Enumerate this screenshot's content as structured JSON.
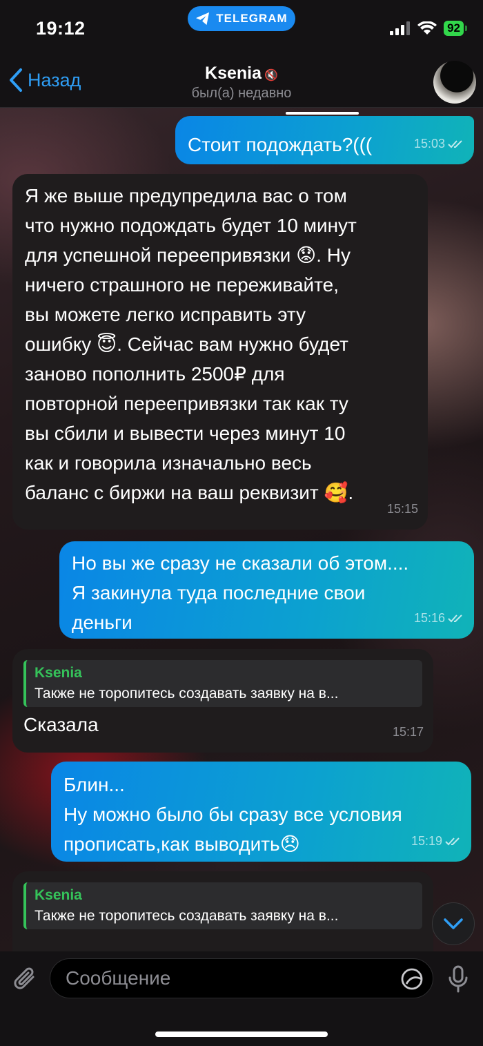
{
  "status_bar": {
    "time": "19:12",
    "app_pill": "TELEGRAM",
    "battery": "92"
  },
  "header": {
    "back_label": "Назад",
    "contact_name": "Ksenia",
    "contact_status": "был(а) недавно"
  },
  "messages": [
    {
      "id": "m1",
      "direction": "out",
      "lines": [
        "Стоит подождать?((("
      ],
      "time": "15:03",
      "read": true
    },
    {
      "id": "m2",
      "direction": "in",
      "lines": [
        "Я же выше предупредила вас о том",
        "что нужно подождать будет 10 минут",
        "для успешной переепривязки 😟. Ну",
        "ничего страшного не переживайте,",
        "вы можете легко исправить эту",
        "ошибку 😇. Сейчас вам нужно будет",
        "заново пополнить 2500₽ для",
        "повторной переепривязки так как ту",
        "вы сбили и вывести через минут 10",
        "как и говорила изначально весь",
        "баланс с биржи на ваш реквизит 🥰."
      ],
      "time": "15:15"
    },
    {
      "id": "m3",
      "direction": "out",
      "lines": [
        "Но вы же сразу не сказали об этом....",
        "Я закинула туда последние свои",
        "деньги"
      ],
      "time": "15:16",
      "read": true
    },
    {
      "id": "m4",
      "direction": "in",
      "reply_name": "Ksenia",
      "reply_text": "Также не торопитесь создавать заявку на в...",
      "lines": [
        "Сказала"
      ],
      "time": "15:17"
    },
    {
      "id": "m5",
      "direction": "out",
      "lines": [
        "Блин...",
        "Ну можно было бы сразу все условия",
        "прописать,как выводить😞"
      ],
      "time": "15:19",
      "read": true
    },
    {
      "id": "m6",
      "direction": "in",
      "reply_name": "Ksenia",
      "reply_text": "Также не торопитесь создавать заявку на в..."
    }
  ],
  "input": {
    "placeholder": "Сообщение"
  },
  "icons": {
    "back": "chevron-left-icon",
    "mute": "muted-speaker-icon",
    "attach": "paperclip-icon",
    "sticker": "sticker-icon",
    "mic": "microphone-icon",
    "scroll": "chevron-down-icon"
  },
  "colors": {
    "accent": "#2f9ef5",
    "outgoing_start": "#0a86e6",
    "outgoing_end": "#10b3b8",
    "incoming": "#1f1c1d",
    "reply_name": "#35c35a"
  }
}
